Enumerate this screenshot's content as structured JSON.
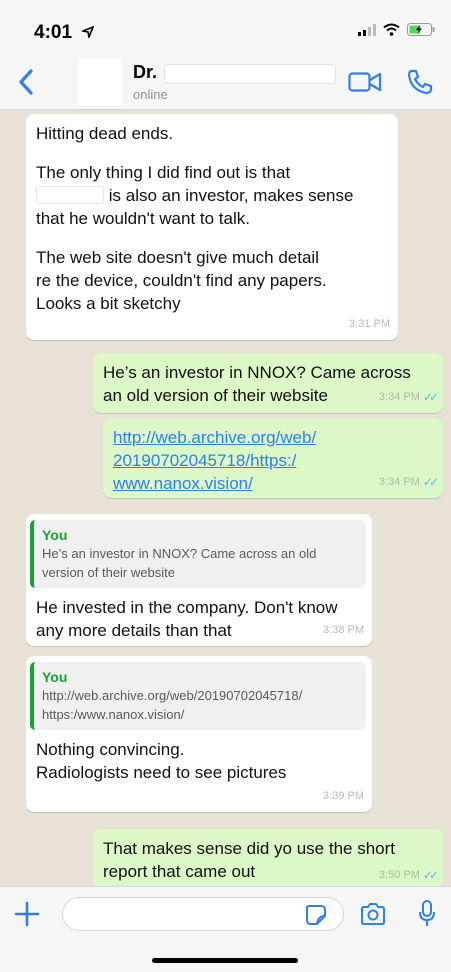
{
  "status_bar": {
    "time": "4:01"
  },
  "header": {
    "contact_name": "Dr.",
    "contact_status": "online"
  },
  "messages": [
    {
      "direction": "in",
      "paragraphs": [
        "Hitting dead ends.",
        "The only thing I did find out is that",
        "is also an investor, makes sense",
        "that he wouldn't want to talk.",
        "The web site doesn't give much detail",
        "re the device, couldn't find any papers.",
        "Looks a bit sketchy"
      ],
      "time": "3:31 PM"
    },
    {
      "direction": "out",
      "lines": [
        "He’s an investor in NNOX? Came across",
        "an old version of their website"
      ],
      "time": "3:34 PM"
    },
    {
      "direction": "out",
      "link_lines": [
        "http://web.archive.org/web/",
        "20190702045718/https:/",
        "www.nanox.vision/"
      ],
      "time": "3:34 PM"
    },
    {
      "direction": "in",
      "quote_author": "You",
      "quote_lines": [
        "He’s an investor in NNOX? Came across an old",
        "version of their website"
      ],
      "lines": [
        "He invested in the company. Don't know",
        "any more details than that"
      ],
      "time": "3:38 PM"
    },
    {
      "direction": "in",
      "quote_author": "You",
      "quote_lines": [
        "http://web.archive.org/web/20190702045718/",
        "https:/www.nanox.vision/"
      ],
      "lines": [
        "Nothing convincing.",
        "Radiologists need to see pictures"
      ],
      "time": "3:39 PM"
    },
    {
      "direction": "out",
      "lines": [
        "That makes sense did yo use the short",
        "report that came out"
      ],
      "time": "3:50 PM"
    }
  ],
  "input": {
    "placeholder": ""
  },
  "icons": {
    "back": "chevron-left-icon",
    "video": "video-camera-icon",
    "phone": "phone-icon",
    "plus": "plus-icon",
    "sticker": "sticker-icon",
    "camera": "camera-icon",
    "mic": "microphone-icon"
  },
  "colors": {
    "accent": "#2f80ed",
    "outgoing_bubble": "#dcf8c6",
    "incoming_bubble": "#ffffff",
    "quote_bar": "#18a136",
    "chat_background": "#e7e1d6",
    "read_tick": "#53bdeb"
  }
}
